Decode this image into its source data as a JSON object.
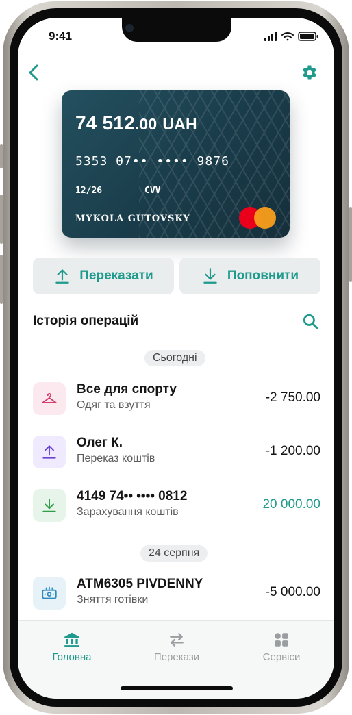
{
  "status_bar": {
    "time": "9:41"
  },
  "header": {
    "back_icon": "chevron-left-icon",
    "settings_icon": "gear-icon"
  },
  "card": {
    "balance_int": "74 512",
    "balance_dec": ".00",
    "currency": "UAH",
    "number": "5353 07•• •••• 9876",
    "expiry": "12/26",
    "cvv_label": "CVV",
    "holder": "MYKOLA GUTOVSKY",
    "network": "mastercard"
  },
  "actions": {
    "transfer": {
      "label": "Переказати",
      "icon": "upload-arrow-icon"
    },
    "topup": {
      "label": "Поповнити",
      "icon": "download-arrow-icon"
    }
  },
  "history": {
    "title": "Історія операцій",
    "groups": [
      {
        "date": "Сьогодні",
        "items": [
          {
            "name": "Все для спорту",
            "category": "Одяг та взуття",
            "amount": "-2 750.00",
            "icon": "hanger-icon"
          },
          {
            "name": "Олег К.",
            "category": "Переказ коштів",
            "amount": "-1 200.00",
            "icon": "upload-arrow-icon"
          },
          {
            "name": "4149 74•• •••• 0812",
            "category": "Зарахування коштів",
            "amount": "20 000.00",
            "icon": "download-arrow-icon"
          }
        ]
      },
      {
        "date": "24 серпня",
        "items": [
          {
            "name": "ATM6305 PIVDENNY",
            "category": "Зняття готівки",
            "amount": "-5 000.00",
            "icon": "cash-icon"
          }
        ]
      }
    ]
  },
  "tabbar": {
    "tabs": [
      {
        "label": "Головна",
        "icon": "bank-icon",
        "active": true
      },
      {
        "label": "Перекази",
        "icon": "swap-arrows-icon",
        "active": false
      },
      {
        "label": "Сервіси",
        "icon": "grid-icon",
        "active": false
      }
    ]
  },
  "colors": {
    "accent": "#1f9a8c",
    "card": "#1f4553",
    "expense_pink": "#fbe9ef",
    "transfer_purple": "#efeafd",
    "income_green": "#e7f4ea",
    "cash_blue": "#e6f2f8"
  }
}
